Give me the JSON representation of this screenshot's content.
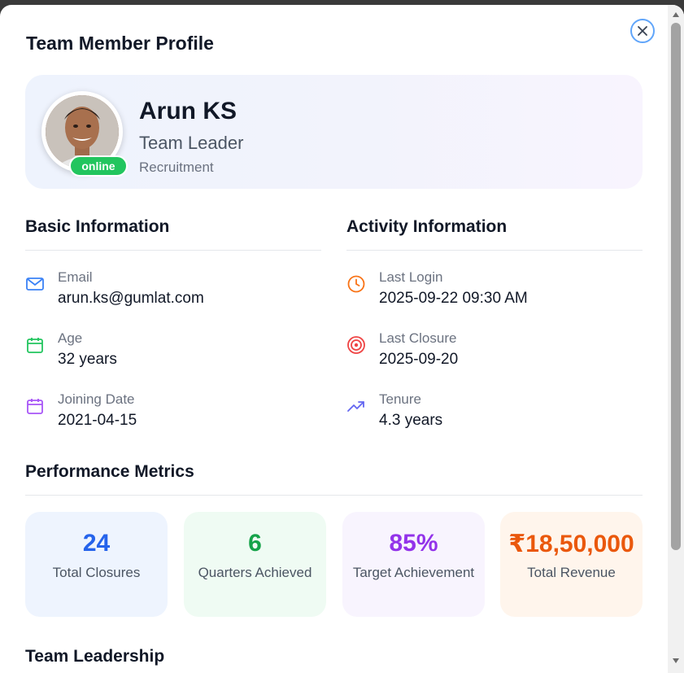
{
  "modal": {
    "title": "Team Member Profile"
  },
  "profile": {
    "name": "Arun KS",
    "role": "Team Leader",
    "department": "Recruitment",
    "status": "online"
  },
  "basic_info": {
    "heading": "Basic Information",
    "items": [
      {
        "label": "Email",
        "value": "arun.ks@gumlat.com",
        "icon": "mail-icon"
      },
      {
        "label": "Age",
        "value": "32 years",
        "icon": "calendar-icon"
      },
      {
        "label": "Joining Date",
        "value": "2021-04-15",
        "icon": "calendar-icon"
      }
    ]
  },
  "activity_info": {
    "heading": "Activity Information",
    "items": [
      {
        "label": "Last Login",
        "value": "2025-09-22 09:30 AM",
        "icon": "clock-icon"
      },
      {
        "label": "Last Closure",
        "value": "2025-09-20",
        "icon": "target-icon"
      },
      {
        "label": "Tenure",
        "value": "4.3 years",
        "icon": "trending-up-icon"
      }
    ]
  },
  "performance": {
    "heading": "Performance Metrics",
    "metrics": [
      {
        "value": "24",
        "label": "Total Closures",
        "color": "#2563eb",
        "bg": "#eef4fe"
      },
      {
        "value": "6",
        "label": "Quarters Achieved",
        "color": "#16a34a",
        "bg": "#effbf3"
      },
      {
        "value": "85%",
        "label": "Target Achievement",
        "color": "#9333ea",
        "bg": "#f8f4fe"
      },
      {
        "value": "₹18,50,000",
        "label": "Total Revenue",
        "color": "#ea580c",
        "bg": "#fff5ec"
      }
    ]
  },
  "team_leadership": {
    "heading": "Team Leadership"
  },
  "colors": {
    "close_ring": "#60a5fa",
    "status_online": "#22c55e"
  }
}
